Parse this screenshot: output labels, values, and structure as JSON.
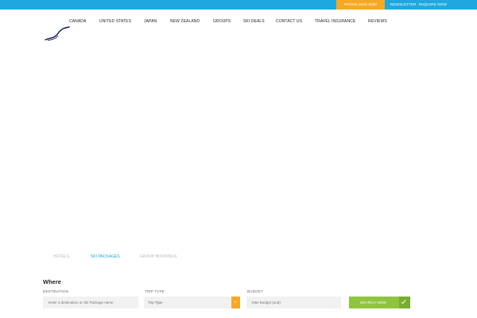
{
  "topbar": {
    "phone_label": "PHONE 9633 5000",
    "newsletter_label": "NEWSLETTER",
    "enquire_label": "ENQUIRE NOW",
    "colors": {
      "bar": "#1fa8e0",
      "phone": "#f6a924"
    }
  },
  "logo": {
    "icon": "wave-logo-icon"
  },
  "nav": {
    "items": [
      "CANADA",
      "UNITED STATES",
      "JAPAN",
      "NEW ZEALAND",
      "GROUPS",
      "SKI DEALS",
      "CONTACT US",
      "TRAVEL INSURANCE",
      "REVIEWS"
    ]
  },
  "tabs": {
    "items": [
      "HOTELS",
      "SKI PACKAGES",
      "GROUP BOOKINGS"
    ],
    "active": "SKI PACKAGES"
  },
  "search": {
    "heading": "Where",
    "destination_label": "DESTINATION",
    "destination_placeholder": "Enter a destination or Ski Package name",
    "trip_type_label": "TRIP TYPE",
    "trip_type_value": "Trip Type",
    "budget_label": "BUDGET",
    "budget_placeholder": "Max Budget (aud)",
    "submit_label": "SEARCH NOW",
    "colors": {
      "submit": "#8fc43d",
      "select_arrow": "#f6a924"
    }
  }
}
